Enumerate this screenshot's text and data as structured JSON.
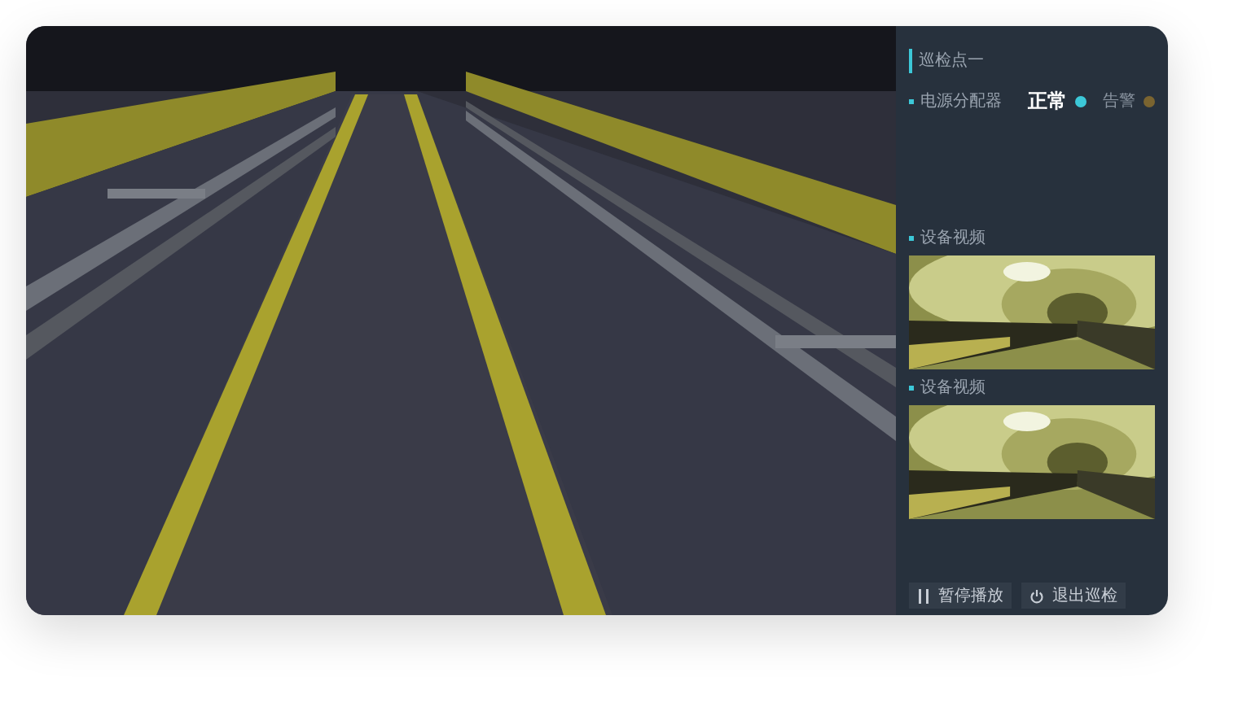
{
  "panel": {
    "title": "巡检点一",
    "device": "电源分配器",
    "status": [
      {
        "label": "正常",
        "selected": true,
        "color": "#3cc8d8"
      },
      {
        "label": "告警",
        "selected": false,
        "color": "#7a6430"
      }
    ],
    "videos": [
      {
        "label": "设备视频"
      },
      {
        "label": "设备视频"
      }
    ],
    "buttons": [
      {
        "kind": "pause",
        "label": "暂停播放"
      },
      {
        "kind": "exit",
        "label": "退出巡检"
      }
    ]
  }
}
